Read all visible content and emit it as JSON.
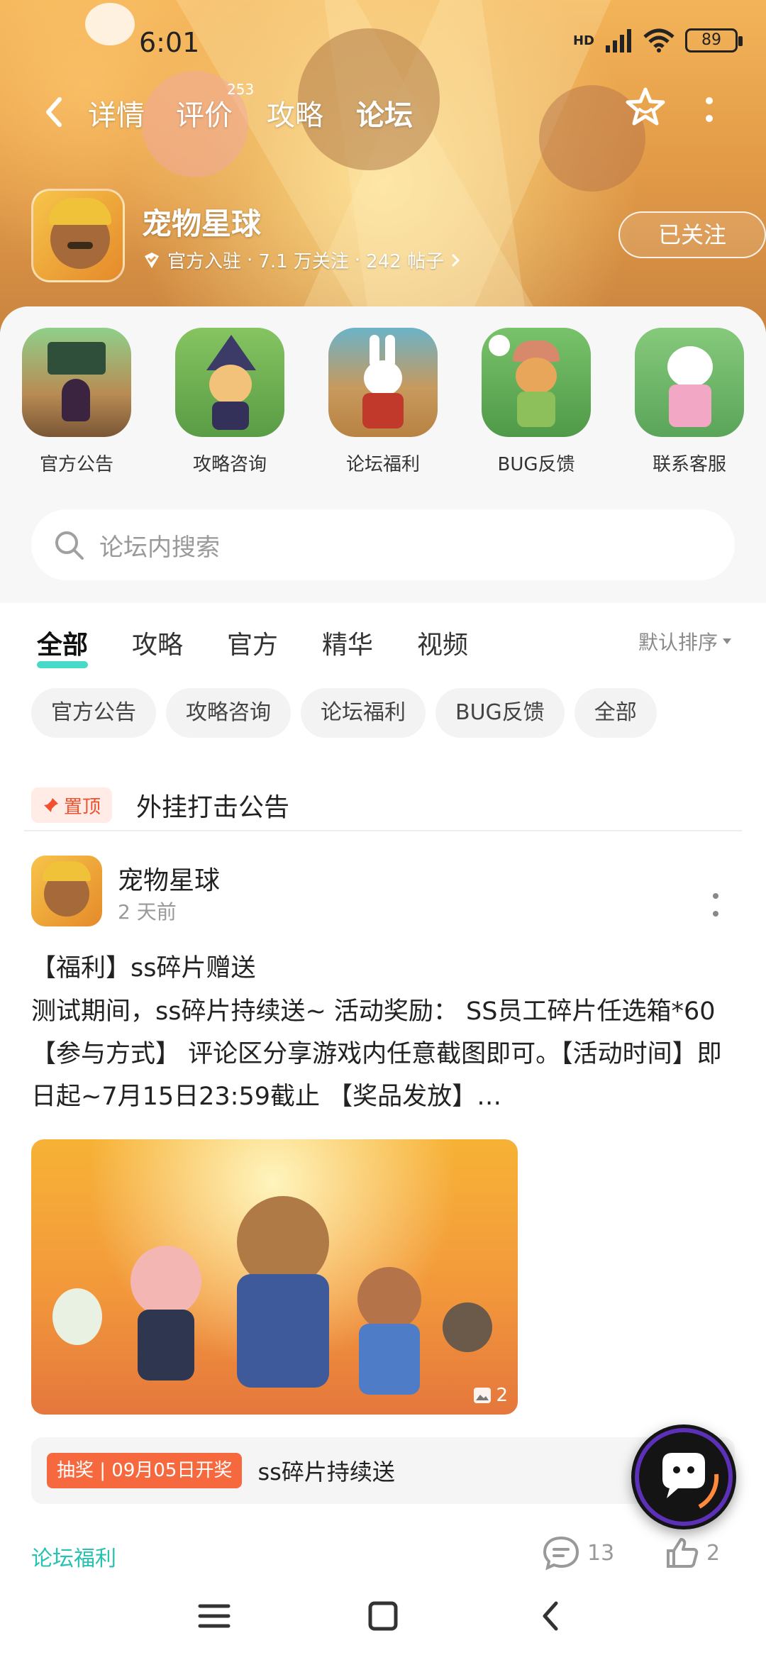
{
  "status_bar": {
    "time": "6:01",
    "network": "HD",
    "battery": "89"
  },
  "nav": {
    "tabs": [
      {
        "label": "详情"
      },
      {
        "label": "评价"
      },
      {
        "label": "攻略"
      },
      {
        "label": "论坛"
      }
    ],
    "rating_count": "253",
    "active_tab": "论坛"
  },
  "game": {
    "name": "宠物星球",
    "official": "官方入驻",
    "followers": "7.1 万关注",
    "posts": "242 帖子",
    "separator": "·",
    "follow_label": "已关注"
  },
  "shortcuts": [
    {
      "label": "官方公告"
    },
    {
      "label": "攻略咨询"
    },
    {
      "label": "论坛福利"
    },
    {
      "label": "BUG反馈"
    },
    {
      "label": "联系客服"
    }
  ],
  "search": {
    "placeholder": "论坛内搜索"
  },
  "filter_tabs": [
    {
      "label": "全部"
    },
    {
      "label": "攻略"
    },
    {
      "label": "官方"
    },
    {
      "label": "精华"
    },
    {
      "label": "视频"
    }
  ],
  "sort_label": "默认排序",
  "chips": [
    {
      "label": "官方公告"
    },
    {
      "label": "攻略咨询"
    },
    {
      "label": "论坛福利"
    },
    {
      "label": "BUG反馈"
    },
    {
      "label": "全部"
    }
  ],
  "pinned": {
    "badge": "置顶",
    "title": "外挂打击公告"
  },
  "post": {
    "author": "宠物星球",
    "time": "2 天前",
    "title": "【福利】ss碎片赠送",
    "body": "测试期间，ss碎片持续送~ 活动奖励： SS员工碎片任选箱*60 【参与方式】 评论区分享游戏内任意截图即可。【活动时间】即日起~7月15日23:59截止 【奖品发放】…",
    "image_count": "2",
    "lottery_tag": "抽奖 | 09月05日开奖",
    "lottery_text": "ss碎片持续送",
    "tag": "论坛福利",
    "comments": "13",
    "likes": "2"
  },
  "colors": {
    "accent": "#27d3c0",
    "pin": "#f0502d",
    "lottery": "#f6693f"
  },
  "icons": [
    "back-icon",
    "star-icon",
    "more-icon",
    "verified-icon",
    "chevron-right-icon",
    "search-icon",
    "sort-arrow-icon",
    "pin-icon",
    "image-icon",
    "comment-icon",
    "like-icon",
    "chat-icon",
    "menu-icon",
    "home-icon",
    "back-nav-icon"
  ]
}
